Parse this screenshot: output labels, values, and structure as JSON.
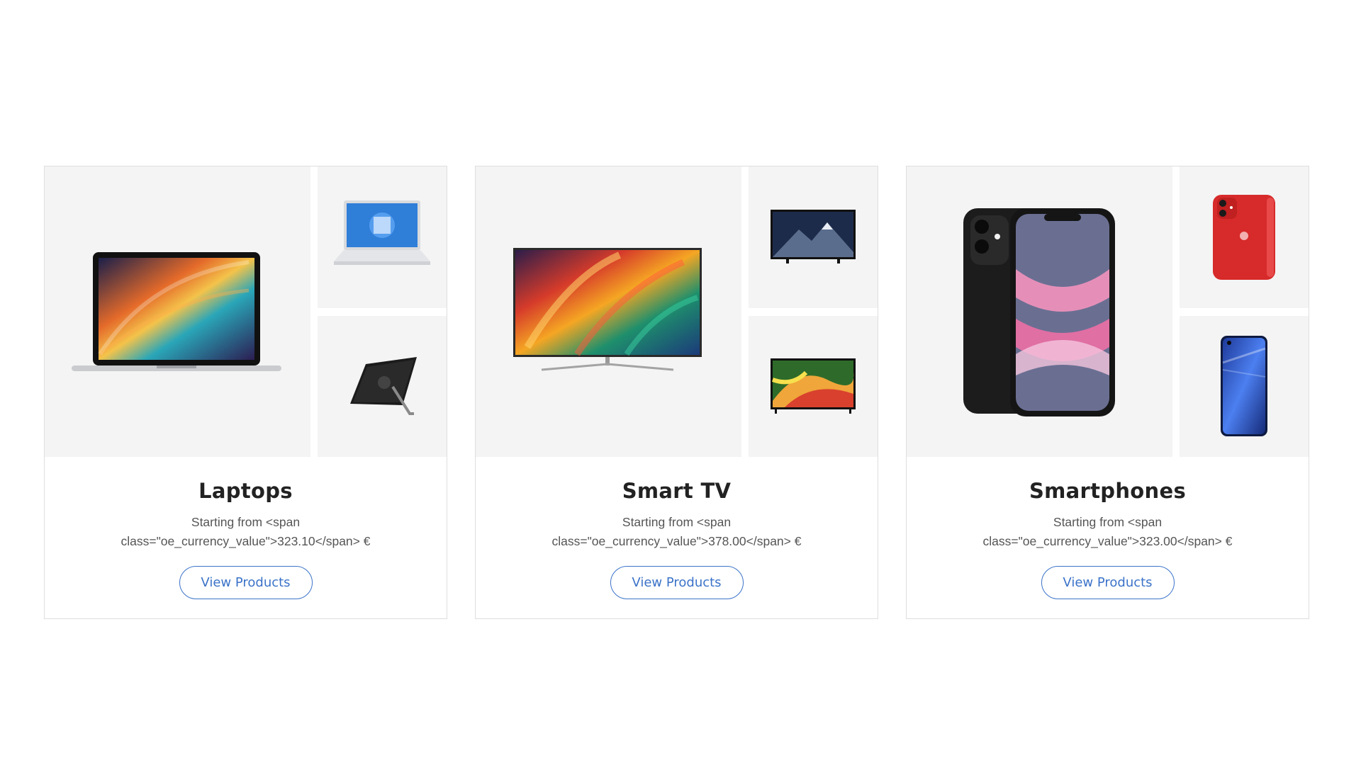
{
  "categories": [
    {
      "title": "Laptops",
      "subtitle_line1": "Starting from <span",
      "subtitle_line2": "class=\"oe_currency_value\">323.10</span> €",
      "button_label": "View Products"
    },
    {
      "title": "Smart TV",
      "subtitle_line1": "Starting from <span",
      "subtitle_line2": "class=\"oe_currency_value\">378.00</span> €",
      "button_label": "View Products"
    },
    {
      "title": "Smartphones",
      "subtitle_line1": "Starting from <span",
      "subtitle_line2": "class=\"oe_currency_value\">323.00</span> €",
      "button_label": "View Products"
    }
  ],
  "colors": {
    "accent": "#3b73c8",
    "tile_bg": "#f4f4f4",
    "border": "#dedede"
  },
  "icons": {
    "card_0": [
      "macbook-laptop-image",
      "hp-laptop-image",
      "surface-tablet-image"
    ],
    "card_1": [
      "qled-tv-image",
      "mountain-tv-image",
      "abstract-tv-image"
    ],
    "card_2": [
      "black-iphone-image",
      "red-iphone-image",
      "blue-android-phone-image"
    ]
  }
}
